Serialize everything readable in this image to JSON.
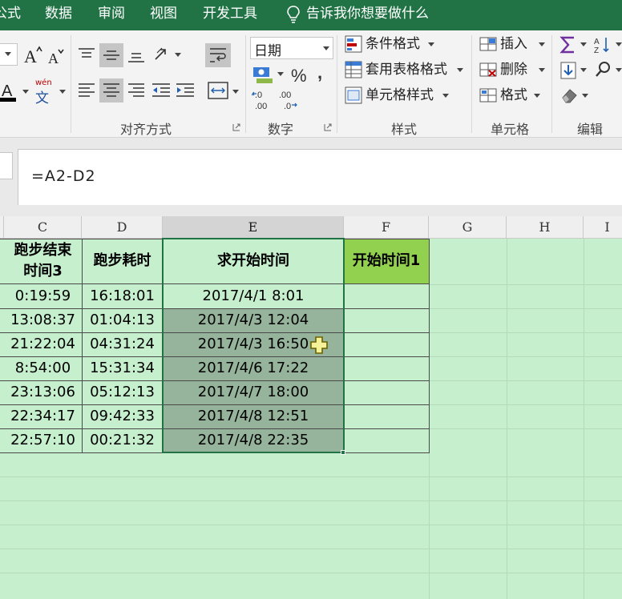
{
  "menu": {
    "tabs": [
      "公式",
      "数据",
      "审阅",
      "视图",
      "开发工具"
    ],
    "tell_me": "告诉我你想要做什么"
  },
  "ribbon": {
    "font_group": {
      "wen_label": "wén",
      "wen_char": "文"
    },
    "number_group": {
      "format_value": "日期",
      "label": "数字"
    },
    "alignment_group": {
      "label": "对齐方式"
    },
    "styles_group": {
      "conditional_format": "条件格式",
      "table_format": "套用表格格式",
      "cell_styles": "单元格样式",
      "label": "样式"
    },
    "cells_group": {
      "insert": "插入",
      "delete": "删除",
      "format": "格式",
      "label": "单元格"
    },
    "editing_group": {
      "label": "编辑"
    }
  },
  "formula_bar": {
    "formula": "=A2-D2"
  },
  "sheet": {
    "columns": [
      "C",
      "D",
      "E",
      "F",
      "G",
      "H",
      "I"
    ],
    "headers": {
      "c_line1": "跑步结束",
      "c_line2": "时间3",
      "d": "跑步耗时",
      "e": "求开始时间",
      "f": "开始时间1"
    },
    "rows": [
      {
        "end_time": "0:19:59",
        "duration": "16:18:01",
        "start_time": "2017/4/1 8:01"
      },
      {
        "end_time": "13:08:37",
        "duration": "01:04:13",
        "start_time": "2017/4/3 12:04"
      },
      {
        "end_time": "21:22:04",
        "duration": "04:31:24",
        "start_time": "2017/4/3 16:50"
      },
      {
        "end_time": "8:54:00",
        "duration": "15:31:34",
        "start_time": "2017/4/6 17:22"
      },
      {
        "end_time": "23:13:06",
        "duration": "05:12:13",
        "start_time": "2017/4/7 18:00"
      },
      {
        "end_time": "22:34:17",
        "duration": "09:42:33",
        "start_time": "2017/4/8 12:51"
      },
      {
        "end_time": "22:57:10",
        "duration": "00:21:32",
        "start_time": "2017/4/8 22:35"
      }
    ]
  },
  "colors": {
    "ribbon_green": "#217346",
    "sheet_fill": "#c6efce",
    "header_fill_f": "#92d050",
    "selected_fill": "#95b49b"
  }
}
